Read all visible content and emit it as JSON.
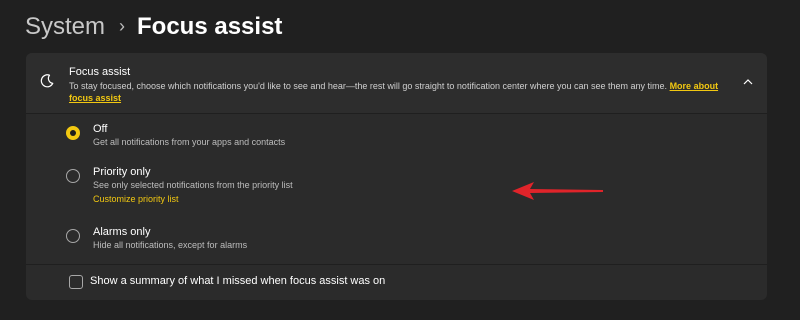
{
  "breadcrumb": {
    "parent": "System",
    "separator": "›",
    "current": "Focus assist"
  },
  "panel": {
    "icon": "moon-icon",
    "title": "Focus assist",
    "description": "To stay focused, choose which notifications you'd like to see and hear—the rest will go straight to notification center where you can see them any time.",
    "link": "More about focus assist",
    "expanded": true
  },
  "options": [
    {
      "label": "Off",
      "description": "Get all notifications from your apps and contacts",
      "selected": true
    },
    {
      "label": "Priority only",
      "description": "See only selected notifications from the priority list",
      "link": "Customize priority list",
      "selected": false
    },
    {
      "label": "Alarms only",
      "description": "Hide all notifications, except for alarms",
      "selected": false
    }
  ],
  "summary_checkbox": {
    "label": "Show a summary of what I missed when focus assist was on",
    "checked": false
  },
  "colors": {
    "accent": "#f2c811",
    "annotation_arrow": "#e0242a",
    "background": "#202020",
    "panel": "#2b2b2b"
  }
}
